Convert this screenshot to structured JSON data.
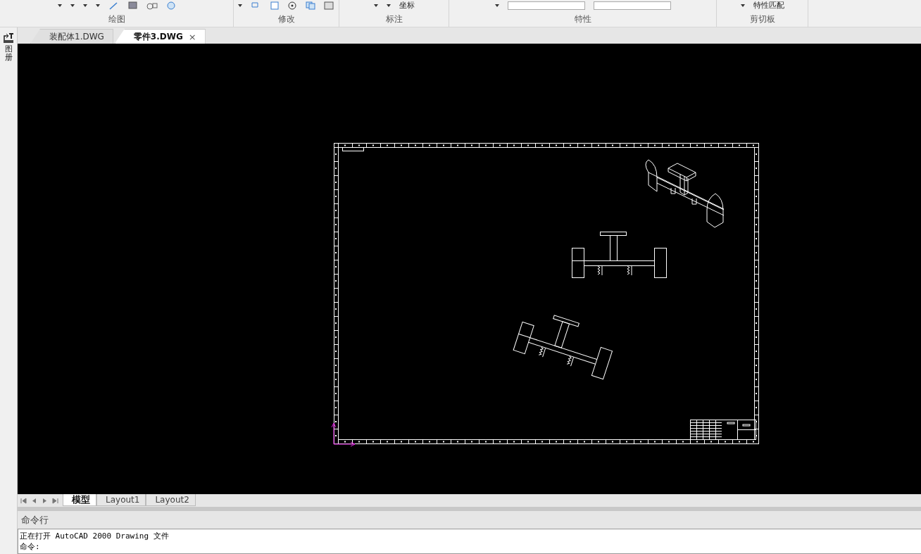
{
  "ribbon": {
    "panels": [
      {
        "label": "绘图",
        "kind": "draw"
      },
      {
        "label": "修改",
        "kind": "modify"
      },
      {
        "label": "标注",
        "kind": "annotate",
        "tool": "坐标"
      },
      {
        "label": "特性",
        "kind": "properties"
      },
      {
        "label": "剪切板",
        "kind": "clipboard",
        "tool": "特性匹配"
      }
    ]
  },
  "side_panel": {
    "label": "图册"
  },
  "document_tabs": [
    {
      "label": "装配体1.DWG",
      "selected": false
    },
    {
      "label": "零件3.DWG",
      "selected": true,
      "close": "×"
    }
  ],
  "layout_tabs": [
    {
      "label": "模型",
      "selected": true
    },
    {
      "label": "Layout1",
      "selected": false
    },
    {
      "label": "Layout2",
      "selected": false
    }
  ],
  "command_window": {
    "title": "命令行",
    "lines": [
      "正在打开 AutoCAD 2000 Drawing 文件",
      "命令:"
    ]
  }
}
